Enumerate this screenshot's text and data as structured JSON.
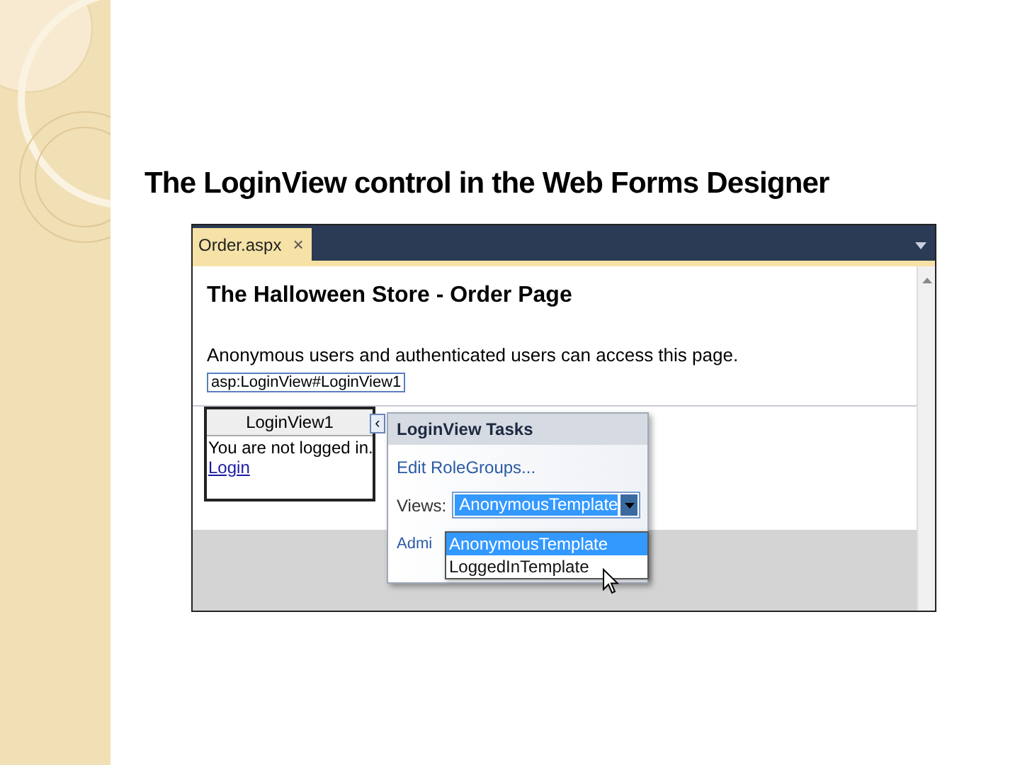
{
  "slide": {
    "title": "The LoginView control in the Web Forms Designer"
  },
  "editor": {
    "tab": {
      "label": "Order.aspx",
      "close": "×"
    },
    "heading": "The Halloween Store - Order Page",
    "paragraph": "Anonymous users and authenticated users can access this page.",
    "control_tag": "asp:LoginView#LoginView1",
    "login_view": {
      "title": "LoginView1",
      "message": "You are not logged in.",
      "link": "Login"
    },
    "smart_tag": "‹",
    "tasks": {
      "title": "LoginView Tasks",
      "edit_link": "Edit RoleGroups...",
      "views_label": "Views:",
      "views_value": "AnonymousTemplate",
      "admin_link": "Admi",
      "options": [
        {
          "label": "AnonymousTemplate",
          "selected": true
        },
        {
          "label": "LoggedInTemplate",
          "selected": false
        }
      ]
    }
  }
}
